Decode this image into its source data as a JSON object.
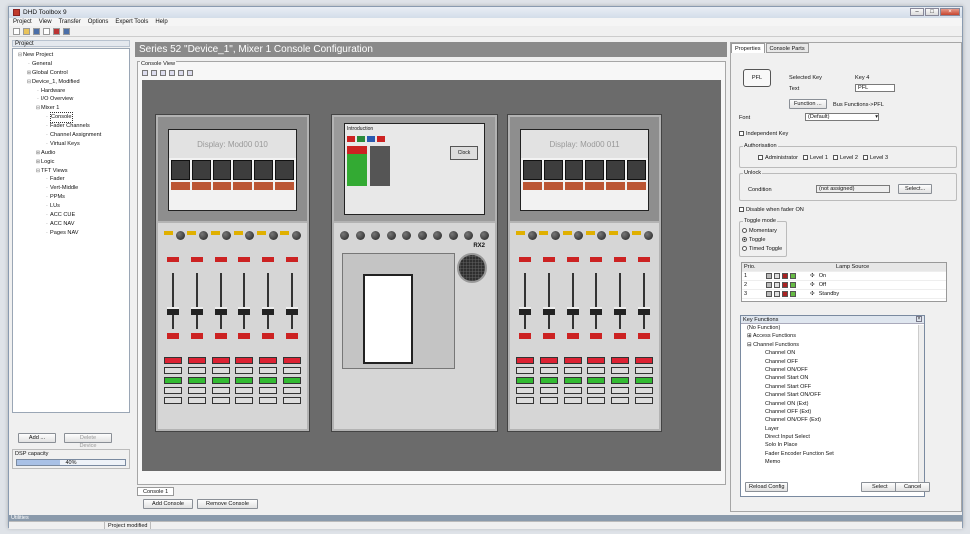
{
  "window": {
    "title": "DHD Toolbox 9"
  },
  "menu": [
    "Project",
    "View",
    "Transfer",
    "Options",
    "Expert Tools",
    "Help"
  ],
  "left": {
    "title": "Project",
    "tree": [
      {
        "label": "New Project",
        "d": 0,
        "t": "-"
      },
      {
        "label": "General",
        "d": 1,
        "t": ""
      },
      {
        "label": "Global Control",
        "d": 1,
        "t": "+"
      },
      {
        "label": "Device_1, Modified",
        "d": 1,
        "t": "-"
      },
      {
        "label": "Hardware",
        "d": 2,
        "t": ""
      },
      {
        "label": "I/O Overview",
        "d": 2,
        "t": ""
      },
      {
        "label": "Mixer 1",
        "d": 2,
        "t": "-"
      },
      {
        "label": "Console",
        "d": 3,
        "t": "",
        "sel": true
      },
      {
        "label": "Fader Channels",
        "d": 3,
        "t": ""
      },
      {
        "label": "Channel Assignment",
        "d": 3,
        "t": ""
      },
      {
        "label": "Virtual Keys",
        "d": 3,
        "t": ""
      },
      {
        "label": "Audio",
        "d": 2,
        "t": "+"
      },
      {
        "label": "Logic",
        "d": 2,
        "t": "+"
      },
      {
        "label": "TFT Views",
        "d": 2,
        "t": "-"
      },
      {
        "label": "Fader",
        "d": 3,
        "t": ""
      },
      {
        "label": "Vert-Middle",
        "d": 3,
        "t": ""
      },
      {
        "label": "PPMs",
        "d": 3,
        "t": ""
      },
      {
        "label": "LUs",
        "d": 3,
        "t": ""
      },
      {
        "label": "ACC CUE",
        "d": 3,
        "t": ""
      },
      {
        "label": "ACC NAV",
        "d": 3,
        "t": ""
      },
      {
        "label": "Pages NAV",
        "d": 3,
        "t": ""
      }
    ],
    "add_label": "Add ...",
    "delete_label": "Delete Device",
    "dsp_label": "DSP capacity",
    "dsp_value": "40%",
    "dsp_fraction": 0.4
  },
  "center": {
    "header": "Series 52 \"Device_1\", Mixer 1 Console Configuration",
    "view_label": "Console View",
    "display_left": "Display: Mod00 010",
    "display_right": "Display: Mod00 011",
    "center_screen_title": "Introduction",
    "center_clock": "Clock",
    "rx2": "RX2",
    "tab": "Console 1",
    "add_console": "Add Console",
    "remove_console": "Remove Console"
  },
  "right": {
    "tabs": [
      "Properties",
      "Console Parts"
    ],
    "key_preview": "PFL",
    "selected_key_label": "Selected Key",
    "selected_key_value": "Key 4",
    "text_label": "Text",
    "text_value": "PFL",
    "function_btn": "Function ...",
    "bus_label": "Bus Functions->PFL",
    "font_label": "Font",
    "font_value": "(Default)",
    "independent": "Independent Key",
    "auth_title": "Authorisation",
    "auth": [
      "Administrator",
      "Level 1",
      "Level 2",
      "Level 3"
    ],
    "unlock_title": "Unlock",
    "condition_label": "Condition",
    "condition_value": "(not assigned)",
    "select_btn": "Select...",
    "disable_label": "Disable when fader ON",
    "toggle_title": "Toggle mode",
    "toggle_options": [
      "Momentary",
      "Toggle",
      "Timed Toggle"
    ],
    "lamp_headers": [
      "Prio.",
      "Lamp Source"
    ],
    "lamps": [
      {
        "prio": "1",
        "src": "On"
      },
      {
        "prio": "2",
        "src": "Off"
      },
      {
        "prio": "3",
        "src": "Standby"
      }
    ],
    "kf_title": "Key Functions",
    "kf_items": [
      {
        "label": "(No Function)",
        "d": 0
      },
      {
        "label": "Access Functions",
        "d": 0,
        "t": "+"
      },
      {
        "label": "Channel Functions",
        "d": 0,
        "t": "-"
      },
      {
        "label": "Channel ON",
        "d": 1
      },
      {
        "label": "Channel OFF",
        "d": 1
      },
      {
        "label": "Channel ON/OFF",
        "d": 1
      },
      {
        "label": "Channel Start ON",
        "d": 1
      },
      {
        "label": "Channel Start OFF",
        "d": 1
      },
      {
        "label": "Channel Start ON/OFF",
        "d": 1
      },
      {
        "label": "Channel ON (Ext)",
        "d": 1
      },
      {
        "label": "Channel OFF (Ext)",
        "d": 1
      },
      {
        "label": "Channel ON/OFF (Ext)",
        "d": 1
      },
      {
        "label": "Layer",
        "d": 1
      },
      {
        "label": "Direct Input Select",
        "d": 1
      },
      {
        "label": "Solo In Place",
        "d": 1
      },
      {
        "label": "Fader Encoder Function Set",
        "d": 1
      },
      {
        "label": "Memo",
        "d": 1
      }
    ],
    "reload_btn": "Reload Config",
    "kf_select": "Select",
    "kf_cancel": "Cancel"
  },
  "status": {
    "section": "Utilities",
    "message": "Project modified"
  }
}
